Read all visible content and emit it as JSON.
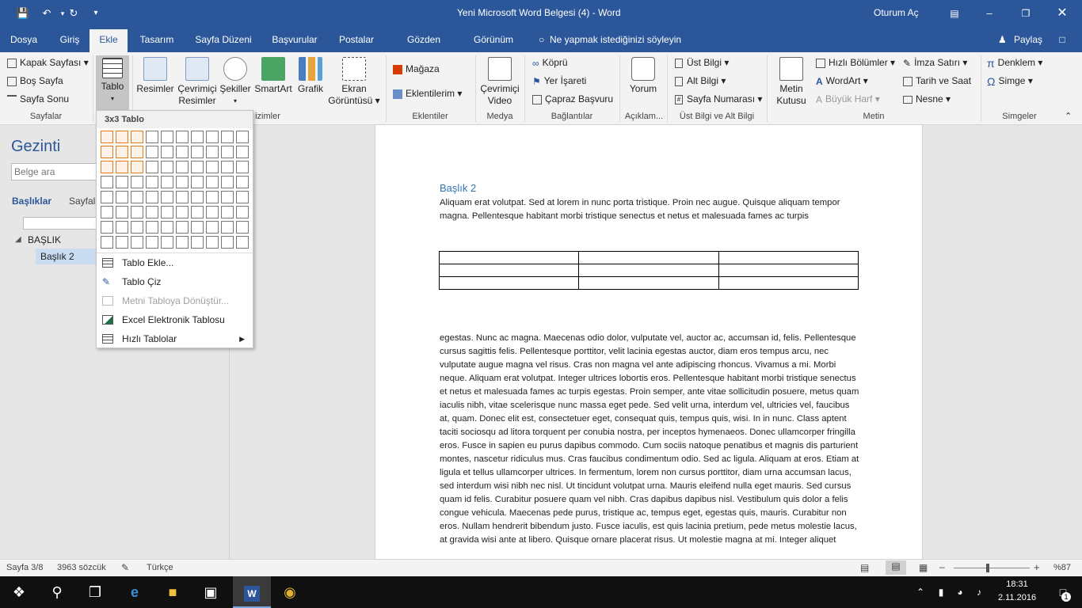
{
  "window": {
    "title": "Yeni Microsoft Word Belgesi (4)  -  Word",
    "signin": "Oturum Aç"
  },
  "tabs": [
    "Dosya",
    "Giriş",
    "Ekle",
    "Tasarım",
    "Sayfa Düzeni",
    "Başvurular",
    "Postalar",
    "Gözden Geçir",
    "Görünüm"
  ],
  "tell_me": "Ne yapmak istediğinizi söyleyin",
  "share": "Paylaş",
  "ribbon": {
    "pages": {
      "cover": "Kapak Sayfası",
      "blank": "Boş Sayfa",
      "break": "Sayfa Sonu",
      "label": "Sayfalar"
    },
    "table": {
      "label": "Tablo"
    },
    "illus": {
      "pictures": "Resimler",
      "online_pictures": "Çevrimiçi Resimler",
      "shapes": "Şekiller",
      "smartart": "SmartArt",
      "chart": "Grafik",
      "screenshot": "Ekran Görüntüsü",
      "label": "izimler"
    },
    "addins": {
      "store": "Mağaza",
      "my_addins": "Eklentilerim",
      "label": "Eklentiler"
    },
    "media": {
      "online_video": "Çevrimiçi Video",
      "label": "Medya"
    },
    "links": {
      "hyperlink": "Köprü",
      "bookmark": "Yer İşareti",
      "crossref": "Çapraz Başvuru",
      "label": "Bağlantılar"
    },
    "comments": {
      "comment": "Yorum",
      "label": "Açıklam..."
    },
    "header_footer": {
      "header": "Üst Bilgi",
      "footer": "Alt Bilgi",
      "page_number": "Sayfa Numarası",
      "label": "Üst Bilgi ve Alt Bilgi"
    },
    "text": {
      "textbox": "Metin Kutusu",
      "quickparts": "Hızlı Bölümler",
      "wordart": "WordArt",
      "dropcap": "Büyük Harf",
      "signature": "İmza Satırı",
      "datetime": "Tarih ve Saat",
      "object": "Nesne",
      "label": "Metin"
    },
    "symbols": {
      "equation": "Denklem",
      "symbol": "Simge",
      "label": "Simgeler"
    }
  },
  "nav": {
    "title": "Gezinti",
    "search_placeholder": "Belge ara",
    "tab_headings": "Başlıklar",
    "tab_pages": "Sayfala",
    "heading1": "BAŞLIK",
    "heading2": "Başlık 2"
  },
  "table_menu": {
    "header": "3x3 Tablo",
    "grid": {
      "cols": 10,
      "rows": 8,
      "sel_cols": 3,
      "sel_rows": 3
    },
    "items": [
      "Tablo Ekle...",
      "Tablo Çiz",
      "Metni Tabloya Dönüştür...",
      "Excel Elektronik Tablosu",
      "Hızlı Tablolar"
    ]
  },
  "document": {
    "heading": "Başlık 2",
    "para1": "Aliquam erat volutpat. Sed at lorem in nunc porta tristique. Proin nec augue. Quisque aliquam tempor magna. Pellentesque habitant morbi tristique senectus et netus et malesuada fames ac turpis",
    "para2": "egestas. Nunc ac magna. Maecenas odio dolor, vulputate vel, auctor ac, accumsan id, felis. Pellentesque cursus sagittis felis. Pellentesque porttitor, velit lacinia egestas auctor, diam eros tempus arcu, nec vulputate augue magna vel risus. Cras non magna vel ante adipiscing rhoncus. Vivamus a mi. Morbi neque. Aliquam erat volutpat. Integer ultrices lobortis eros. Pellentesque habitant morbi tristique senectus et netus et malesuada fames ac turpis egestas. Proin semper, ante vitae sollicitudin posuere, metus quam iaculis nibh, vitae scelerisque nunc massa eget pede. Sed velit urna, interdum vel, ultricies vel, faucibus at, quam. Donec elit est, consectetuer eget, consequat quis, tempus quis, wisi. In in nunc. Class aptent taciti sociosqu ad litora torquent per conubia nostra, per inceptos hymenaeos. Donec ullamcorper fringilla eros. Fusce in sapien eu purus dapibus commodo. Cum sociis natoque penatibus et magnis dis parturient montes, nascetur ridiculus mus. Cras faucibus condimentum odio. Sed ac ligula. Aliquam at eros. Etiam at ligula et tellus ullamcorper ultrices. In fermentum, lorem non cursus porttitor, diam urna accumsan lacus, sed interdum wisi nibh nec nisl. Ut tincidunt volutpat urna. Mauris eleifend nulla eget mauris. Sed cursus quam id felis. Curabitur posuere quam vel nibh. Cras dapibus dapibus nisl. Vestibulum quis dolor a felis congue vehicula. Maecenas pede purus, tristique ac, tempus eget, egestas quis, mauris. Curabitur non eros. Nullam hendrerit bibendum justo. Fusce iaculis, est quis lacinia pretium, pede metus molestie lacus, at gravida wisi ante at libero. Quisque ornare placerat risus. Ut molestie magna at mi. Integer aliquet"
  },
  "status": {
    "page": "Sayfa 3/8",
    "words": "3963 sözcük",
    "language": "Türkçe",
    "zoom": "%87"
  },
  "taskbar": {
    "time": "18:31",
    "date": "2.11.2016",
    "notifications": "1"
  },
  "colors": {
    "brand": "#2b579a",
    "selection": "#e07a1f",
    "heading": "#2e74b5"
  }
}
